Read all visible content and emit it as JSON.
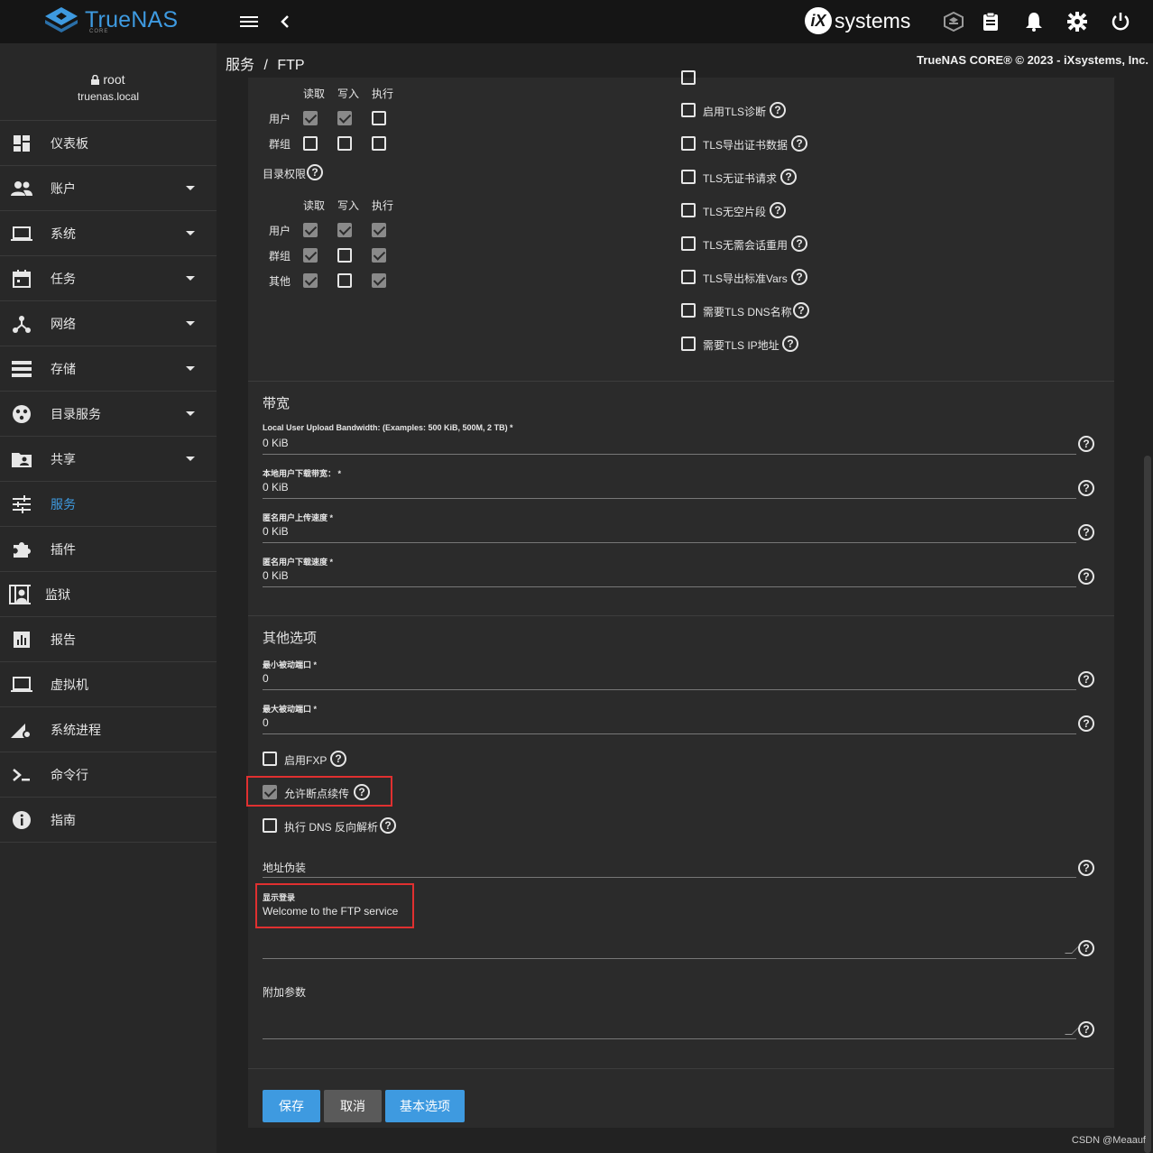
{
  "topbar": {
    "logo_text": "TrueNAS",
    "logo_sub": "CORE",
    "brand_text": "systems",
    "brand_circle": "iX"
  },
  "user": {
    "name": "root",
    "host": "truenas.local"
  },
  "sidebar": {
    "items": [
      {
        "label": "仪表板"
      },
      {
        "label": "账户"
      },
      {
        "label": "系统"
      },
      {
        "label": "任务"
      },
      {
        "label": "网络"
      },
      {
        "label": "存储"
      },
      {
        "label": "目录服务"
      },
      {
        "label": "共享"
      },
      {
        "label": "服务"
      },
      {
        "label": "插件"
      },
      {
        "label": "监狱"
      },
      {
        "label": "报告"
      },
      {
        "label": "虚拟机"
      },
      {
        "label": "系统进程"
      },
      {
        "label": "命令行"
      },
      {
        "label": "指南"
      }
    ]
  },
  "breadcrumb": {
    "parent": "服务",
    "sep": "/",
    "current": "FTP"
  },
  "copyright": "TrueNAS CORE® © 2023 - iXsystems, Inc.",
  "perms": {
    "col_read": "读取",
    "col_write": "写入",
    "col_exec": "执行",
    "row_user": "用户",
    "row_group": "群组",
    "row_other": "其他",
    "dir_perm_label": "目录权限"
  },
  "tls": {
    "diag": "启用TLS诊断",
    "export_cert": "TLS导出证书数据",
    "no_cert_req": "TLS无证书请求",
    "no_empty_frag": "TLS无空片段",
    "no_session_reuse": "TLS无需会话重用",
    "export_vars": "TLS导出标准Vars",
    "dns_name": "需要TLS DNS名称",
    "ip_addr": "需要TLS IP地址"
  },
  "bandwidth": {
    "title": "带宽",
    "fields": [
      {
        "label": "Local User Upload Bandwidth: (Examples: 500 KiB, 500M, 2 TB) *",
        "value": "0 KiB"
      },
      {
        "label": "本地用户下载带宽： *",
        "value": "0 KiB"
      },
      {
        "label": "匿名用户上传速度 *",
        "value": "0 KiB"
      },
      {
        "label": "匿名用户下载速度 *",
        "value": "0 KiB"
      }
    ]
  },
  "other": {
    "title": "其他选项",
    "min_port_label": "最小被动端口 *",
    "min_port_value": "0",
    "max_port_label": "最大被动端口 *",
    "max_port_value": "0",
    "fxp": "启用FXP",
    "resume": "允许断点续传",
    "dns_reverse": "执行 DNS 反向解析",
    "masq_label": "地址伪装",
    "banner_label": "显示登录",
    "banner_value": "Welcome to the FTP service",
    "aux_label": "附加参数"
  },
  "buttons": {
    "save": "保存",
    "cancel": "取消",
    "basic": "基本选项"
  },
  "help_glyph": "?",
  "watermark": "CSDN @Meaauf"
}
